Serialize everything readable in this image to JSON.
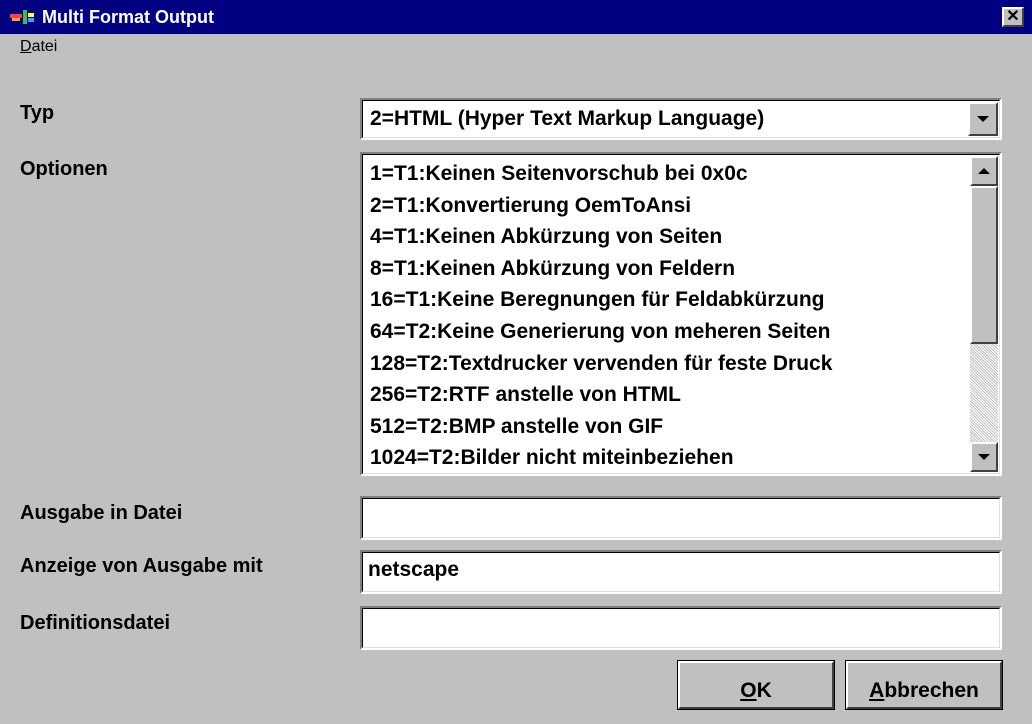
{
  "window": {
    "title": "Multi Format Output",
    "close_glyph": "✕"
  },
  "menu": {
    "datei_first": "D",
    "datei_rest": "atei"
  },
  "form": {
    "typ_label": "Typ",
    "typ_value": "2=HTML (Hyper Text Markup Language)",
    "optionen_label": "Optionen",
    "optionen_items": [
      "1=T1:Keinen Seitenvorschub bei 0x0c",
      "2=T1:Konvertierung OemToAnsi",
      "4=T1:Keinen Abkürzung von Seiten",
      "8=T1:Keinen Abkürzung von Feldern",
      "16=T1:Keine Beregnungen für Feldabkürzung",
      "64=T2:Keine Generierung von meheren Seiten",
      "128=T2:Textdrucker vervenden für feste Druck",
      "256=T2:RTF anstelle von HTML",
      "512=T2:BMP anstelle von GIF",
      "1024=T2:Bilder nicht miteinbeziehen"
    ],
    "ausgabe_label": "Ausgabe in Datei",
    "ausgabe_value": "",
    "anzeige_label": "Anzeige von Ausgabe mit",
    "anzeige_value": "netscape",
    "definitions_label": "Definitionsdatei",
    "definitions_value": ""
  },
  "buttons": {
    "ok_mnemonic": "O",
    "ok_rest": "K",
    "cancel_mnemonic": "A",
    "cancel_rest": "bbrechen"
  },
  "colors": {
    "titlebar": "#000080",
    "face": "#c0c0c0",
    "field": "#ffffff"
  },
  "icons": {
    "app": "app-icon",
    "close": "close-icon",
    "dropdown": "chevron-down-icon",
    "scroll_up": "scroll-up-icon",
    "scroll_down": "scroll-down-icon"
  }
}
